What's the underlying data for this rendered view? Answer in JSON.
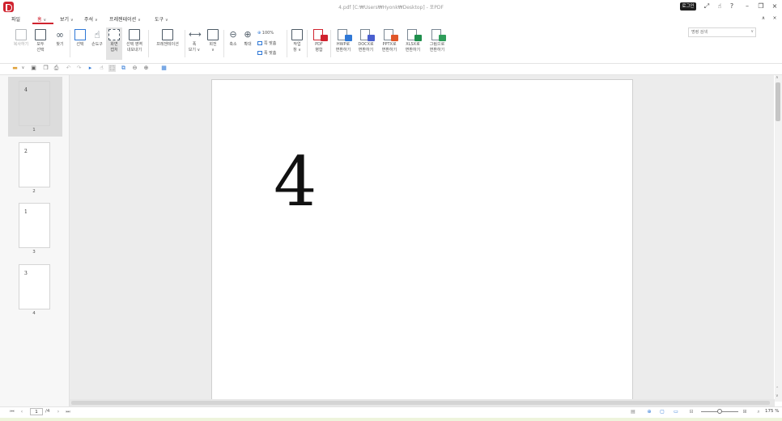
{
  "window": {
    "title": "4.pdf [C:₩Users₩Hyonk₩Desktop] - 포PDF",
    "login_label": "로그인",
    "title_icons": [
      "expand-icon",
      "hand-icon",
      "help-icon",
      "minimize-icon",
      "restore-icon",
      "close-icon"
    ]
  },
  "menu": {
    "items": [
      {
        "label": "파일",
        "has_chevron": false
      },
      {
        "label": "홈",
        "has_chevron": true,
        "active": true
      },
      {
        "label": "보기",
        "has_chevron": true
      },
      {
        "label": "주석",
        "has_chevron": true
      },
      {
        "label": "프레젠테이션",
        "has_chevron": true
      },
      {
        "label": "도구",
        "has_chevron": true
      }
    ],
    "search_placeholder": "명령 검색"
  },
  "ribbon": {
    "buttons": [
      {
        "id": "copy",
        "label": "복사하기"
      },
      {
        "id": "select-all",
        "label": "모두\n선택"
      },
      {
        "id": "find",
        "label": "찾기"
      },
      {
        "id": "select",
        "label": "선택"
      },
      {
        "id": "hand",
        "label": "손도구"
      },
      {
        "id": "screen-capture",
        "label": "화면\n캡처"
      },
      {
        "id": "export-area",
        "label": "선택 영역\n내보내기"
      },
      {
        "id": "presentation",
        "label": "프레젠테이션"
      },
      {
        "id": "fit-width",
        "label": "폭\n보기 ∨"
      },
      {
        "id": "rotate",
        "label": "회전\n∨"
      },
      {
        "id": "zoom-out",
        "label": "축소"
      },
      {
        "id": "zoom-in",
        "label": "확대"
      },
      {
        "id": "page-work",
        "label": "작업\n창 ∨"
      },
      {
        "id": "pdf-merge",
        "label": "PDF\n병합"
      },
      {
        "id": "to-hwp",
        "label": "HWP로\n변환하기"
      },
      {
        "id": "to-docx",
        "label": "DOCX로\n변환하기"
      },
      {
        "id": "to-pptx",
        "label": "PPTX로\n변환하기"
      },
      {
        "id": "to-xlsx",
        "label": "XLSX로\n변환하기"
      },
      {
        "id": "to-image",
        "label": "그림으로\n변환하기"
      }
    ],
    "zoom_options": [
      "100%",
      "쪽 맞춤",
      "폭 맞춤"
    ]
  },
  "thumbnails": [
    {
      "content": "4",
      "number": "1",
      "selected": true
    },
    {
      "content": "2",
      "number": "2",
      "selected": false
    },
    {
      "content": "1",
      "number": "3",
      "selected": false
    },
    {
      "content": "3",
      "number": "4",
      "selected": false
    }
  ],
  "page": {
    "content": "4"
  },
  "status": {
    "current_page": "1",
    "total_pages": "/4",
    "zoom": "175 %"
  },
  "colors": {
    "accent": "#d0232f",
    "hwp": "#2f78d6",
    "docx": "#4a5fcf",
    "pptx": "#e0562a",
    "xlsx": "#1f8f4d",
    "image": "#2f9d5a"
  }
}
